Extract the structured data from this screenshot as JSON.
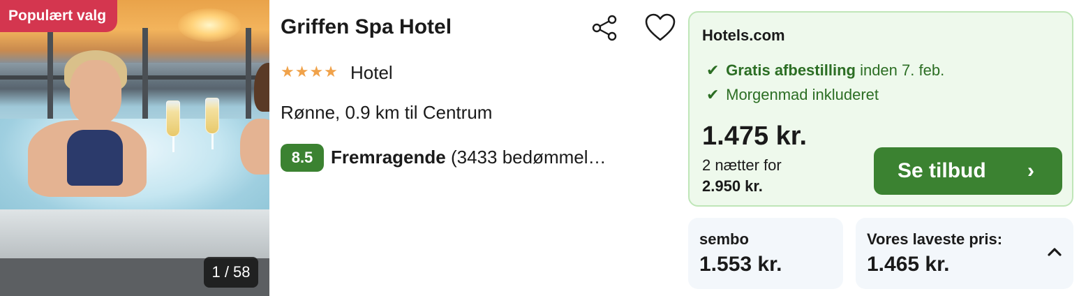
{
  "image": {
    "badge": "Populært valg",
    "counter": "1 / 58"
  },
  "hotel": {
    "name": "Griffen Spa Hotel",
    "stars": "★★★★",
    "star_count": 4,
    "type": "Hotel",
    "location": "Rønne, 0.9 km til Centrum",
    "score": "8.5",
    "rating_word": "Fremragende",
    "reviews": "(3433 bedømmel…"
  },
  "offer": {
    "provider": "Hotels.com",
    "feature1_strong": "Gratis afbestilling",
    "feature1_rest": "inden 7. feb.",
    "feature2": "Morgenmad inkluderet",
    "check": "✔",
    "price": "1.475 kr.",
    "nights": "2 nætter for",
    "total": "2.950 kr.",
    "cta": "Se tilbud",
    "cta_chevron": "›"
  },
  "cards": {
    "provider2_label": "sembo",
    "provider2_price": "1.553 kr.",
    "lowest_label": "Vores laveste pris:",
    "lowest_price": "1.465 kr."
  },
  "colors": {
    "accent_green": "#3b8231",
    "badge_red": "#d4364f",
    "star_orange": "#f0a24a",
    "offer_bg": "#eef9ec"
  },
  "icons": {
    "share": "share-icon",
    "favorite": "heart-icon",
    "collapse": "chevron-up-icon"
  }
}
